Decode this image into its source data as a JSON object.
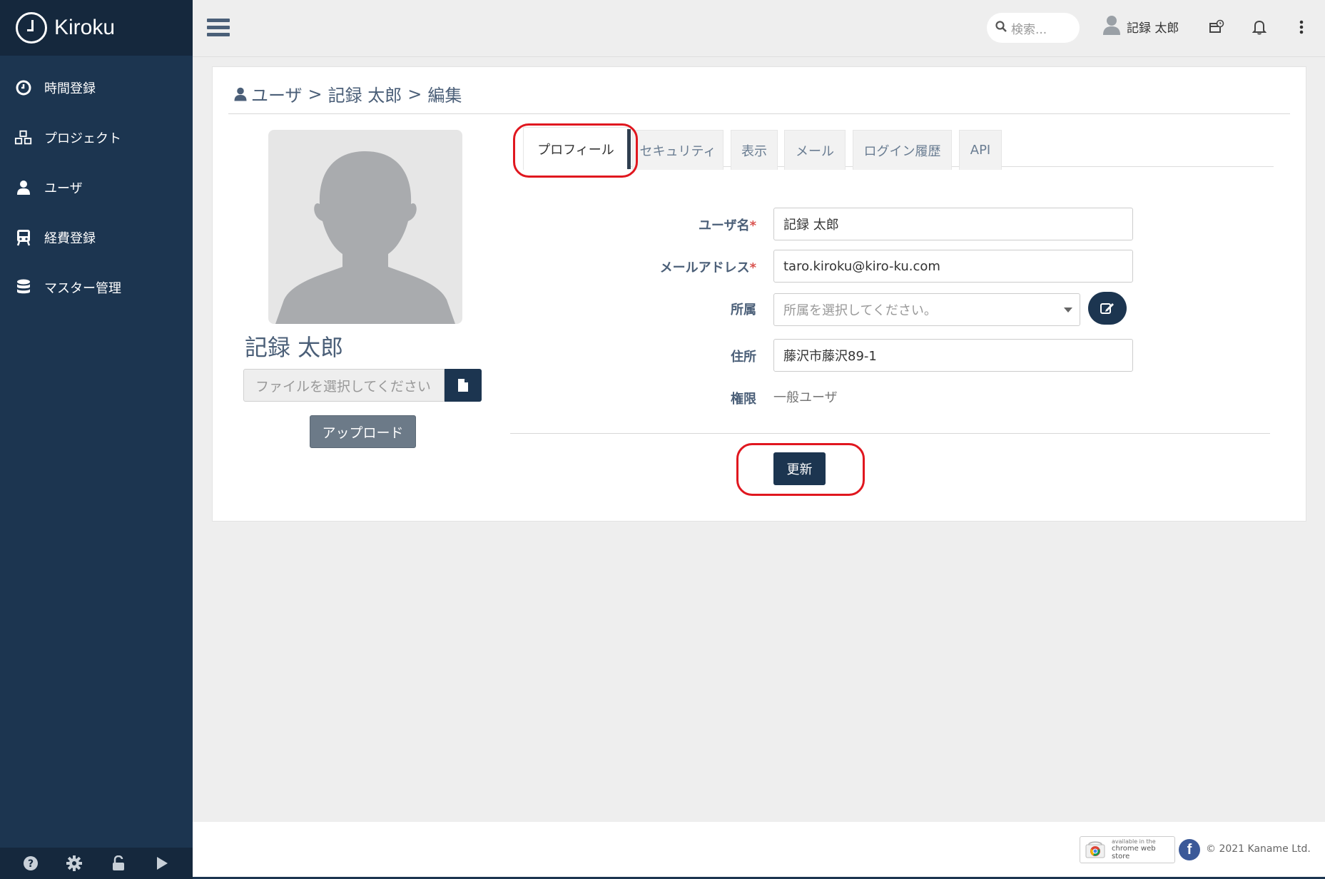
{
  "brand": {
    "name": "Kiroku"
  },
  "sidebar": {
    "items": [
      {
        "label": "時間登録",
        "icon": "clock-icon"
      },
      {
        "label": "プロジェクト",
        "icon": "cubes-icon"
      },
      {
        "label": "ユーザ",
        "icon": "user-icon"
      },
      {
        "label": "経費登録",
        "icon": "train-icon"
      },
      {
        "label": "マスター管理",
        "icon": "database-icon"
      }
    ],
    "footer_icons": [
      "help-icon",
      "settings-icon",
      "lock-icon",
      "play-icon"
    ]
  },
  "topbar": {
    "search_placeholder": "検索...",
    "user_name": "記録 太郎"
  },
  "breadcrumb": {
    "items": [
      "ユーザ",
      "記録 太郎",
      "編集"
    ],
    "separator": ">"
  },
  "profile": {
    "name": "記録 太郎",
    "file_placeholder": "ファイルを選択してください",
    "upload_label": "アップロード"
  },
  "tabs": [
    {
      "label": "プロフィール",
      "active": true
    },
    {
      "label": "セキュリティ",
      "active": false
    },
    {
      "label": "表示",
      "active": false
    },
    {
      "label": "メール",
      "active": false
    },
    {
      "label": "ログイン履歴",
      "active": false
    },
    {
      "label": "API",
      "active": false
    }
  ],
  "form": {
    "username_label": "ユーザ名",
    "username_value": "記録 太郎",
    "email_label": "メールアドレス",
    "email_value": "taro.kiroku@kiro-ku.com",
    "affiliation_label": "所属",
    "affiliation_placeholder": "所属を選択してください。",
    "address_label": "住所",
    "address_value": "藤沢市藤沢89-1",
    "role_label": "権限",
    "role_value": "一般ユーザ",
    "required_mark": "*",
    "submit_label": "更新"
  },
  "footer": {
    "chrome_line1": "available in the",
    "chrome_line2": "chrome web store",
    "facebook_letter": "f",
    "copyright": "© 2021 Kaname Ltd."
  },
  "colors": {
    "sidebar": "#1c3550",
    "primary_button": "#1c3550",
    "annotation": "#e0171f"
  }
}
